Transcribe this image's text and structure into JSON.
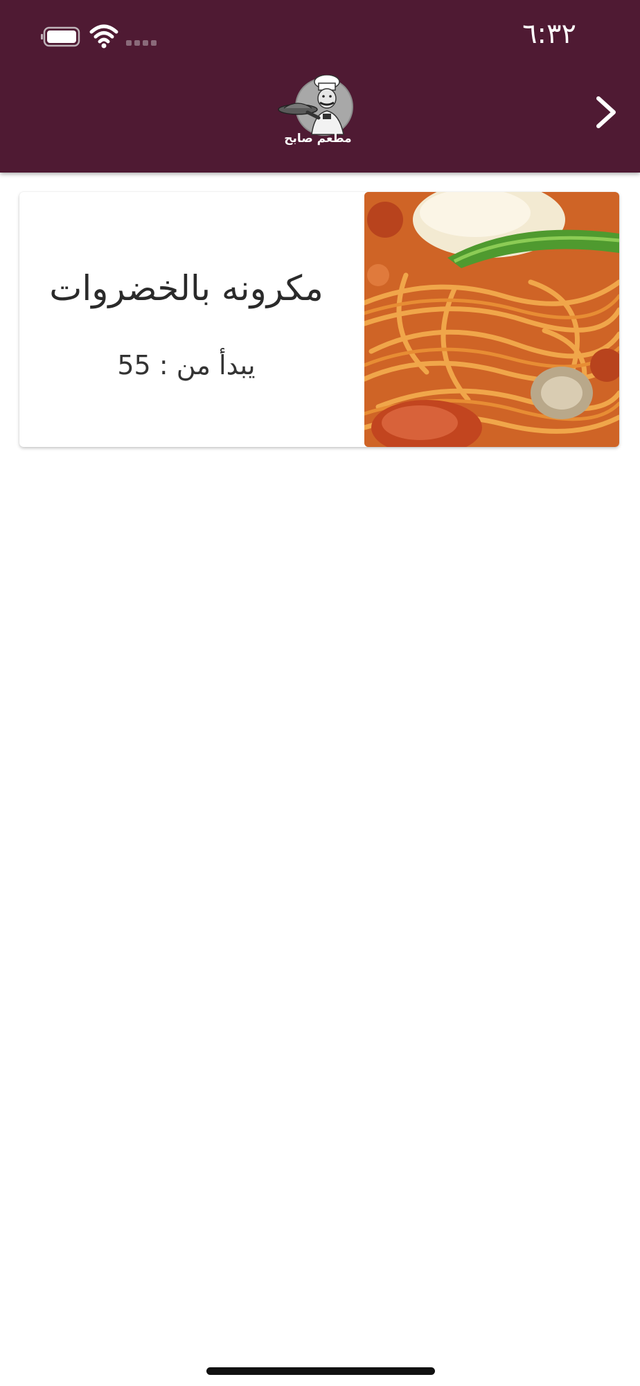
{
  "status_bar": {
    "time": "٦:٣٢",
    "icons": [
      "battery-icon",
      "wifi-icon",
      "signal-icon"
    ]
  },
  "header": {
    "logo_text": "مطعم صابح",
    "back_icon": "chevron-right-icon",
    "background_color": "#4f1a33"
  },
  "menu": {
    "items": [
      {
        "name": "مكرونه بالخضروات",
        "price_label": "يبدأ من : 55",
        "image": "pasta-photo"
      }
    ]
  }
}
